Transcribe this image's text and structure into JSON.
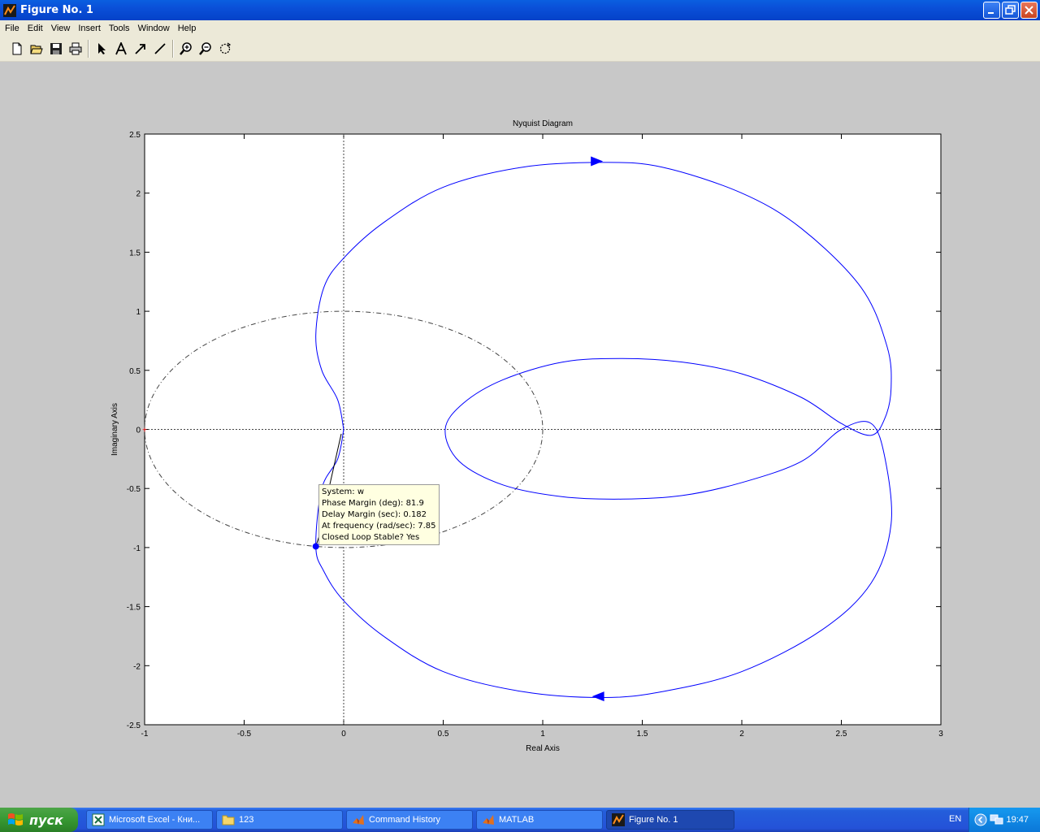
{
  "window": {
    "title": "Figure No. 1"
  },
  "menu": [
    "File",
    "Edit",
    "View",
    "Insert",
    "Tools",
    "Window",
    "Help"
  ],
  "toolbar": {
    "buttons": [
      "new-file-icon",
      "open-folder-icon",
      "save-icon",
      "print-icon",
      "select-arrow-icon",
      "insert-text-icon",
      "insert-arrow-icon",
      "insert-line-icon",
      "zoom-in-icon",
      "zoom-out-icon",
      "rotate-icon"
    ]
  },
  "chart_data": {
    "type": "line",
    "title": "Nyquist Diagram",
    "xlabel": "Real Axis",
    "ylabel": "Imaginary Axis",
    "xlim": [
      -1,
      3
    ],
    "ylim": [
      -2.5,
      2.5
    ],
    "xticks": [
      "-1",
      "-0.5",
      "0",
      "0.5",
      "1",
      "1.5",
      "2",
      "2.5",
      "3"
    ],
    "yticks": [
      "2.5",
      "2",
      "1.5",
      "1",
      "0.5",
      "0",
      "-0.5",
      "-1",
      "-1.5",
      "-2",
      "-2.5"
    ],
    "grid": false,
    "series": [
      {
        "color": "#0000ff",
        "points": [
          [
            0,
            0
          ],
          [
            -0.03,
            0.25
          ],
          [
            -0.11,
            0.5
          ],
          [
            -0.14,
            0.8
          ],
          [
            -0.1,
            1.2
          ],
          [
            0,
            1.45
          ],
          [
            0.2,
            1.75
          ],
          [
            0.5,
            2.05
          ],
          [
            0.9,
            2.22
          ],
          [
            1.3,
            2.26
          ],
          [
            1.6,
            2.22
          ],
          [
            2.0,
            2.0
          ],
          [
            2.3,
            1.7
          ],
          [
            2.6,
            1.2
          ],
          [
            2.73,
            0.7
          ],
          [
            2.75,
            0.35
          ],
          [
            2.72,
            0.1
          ],
          [
            2.65,
            -0.05
          ],
          [
            2.5,
            0.05
          ],
          [
            2.3,
            0.27
          ],
          [
            2.0,
            0.47
          ],
          [
            1.7,
            0.57
          ],
          [
            1.4,
            0.6
          ],
          [
            1.1,
            0.57
          ],
          [
            0.8,
            0.42
          ],
          [
            0.6,
            0.22
          ],
          [
            0.51,
            0
          ],
          [
            0.58,
            -0.27
          ],
          [
            0.8,
            -0.47
          ],
          [
            1.1,
            -0.57
          ],
          [
            1.4,
            -0.59
          ],
          [
            1.7,
            -0.56
          ],
          [
            2.0,
            -0.45
          ],
          [
            2.3,
            -0.27
          ],
          [
            2.5,
            0.0
          ],
          [
            2.65,
            0.05
          ],
          [
            2.72,
            -0.25
          ],
          [
            2.75,
            -0.8
          ],
          [
            2.65,
            -1.3
          ],
          [
            2.4,
            -1.7
          ],
          [
            2.0,
            -2.05
          ],
          [
            1.6,
            -2.22
          ],
          [
            1.3,
            -2.27
          ],
          [
            0.9,
            -2.22
          ],
          [
            0.5,
            -2.05
          ],
          [
            0.2,
            -1.75
          ],
          [
            0,
            -1.45
          ],
          [
            -0.1,
            -1.2
          ],
          [
            -0.14,
            -0.99
          ],
          [
            -0.11,
            -0.5
          ],
          [
            -0.03,
            -0.25
          ],
          [
            0,
            0
          ]
        ]
      }
    ],
    "unit_circle": {
      "style": "dash-dot",
      "color": "#444444",
      "center": [
        0,
        0
      ],
      "radius": 1
    },
    "arrows": [
      [
        1.27,
        2.27
      ],
      [
        1.28,
        -2.26
      ]
    ],
    "marker_point": [
      -0.14,
      -0.99
    ],
    "critical_point": [
      -1,
      0
    ]
  },
  "datatip": {
    "lines": [
      "System: w",
      "Phase Margin (deg): 81.9",
      "Delay Margin (sec): 0.182",
      "At frequency (rad/sec): 7.85",
      "Closed Loop Stable? Yes"
    ]
  },
  "taskbar": {
    "start_label": "пуск",
    "tasks": [
      {
        "label": "Microsoft Excel - Кни...",
        "icon": "excel-icon",
        "active": false
      },
      {
        "label": "123",
        "icon": "folder-icon",
        "active": false
      },
      {
        "label": "Command History",
        "icon": "matlab-icon",
        "active": false
      },
      {
        "label": "MATLAB",
        "icon": "matlab-icon",
        "active": false
      },
      {
        "label": "Figure No. 1",
        "icon": "figure-icon",
        "active": true
      }
    ],
    "language": "EN",
    "clock": "19:47"
  }
}
